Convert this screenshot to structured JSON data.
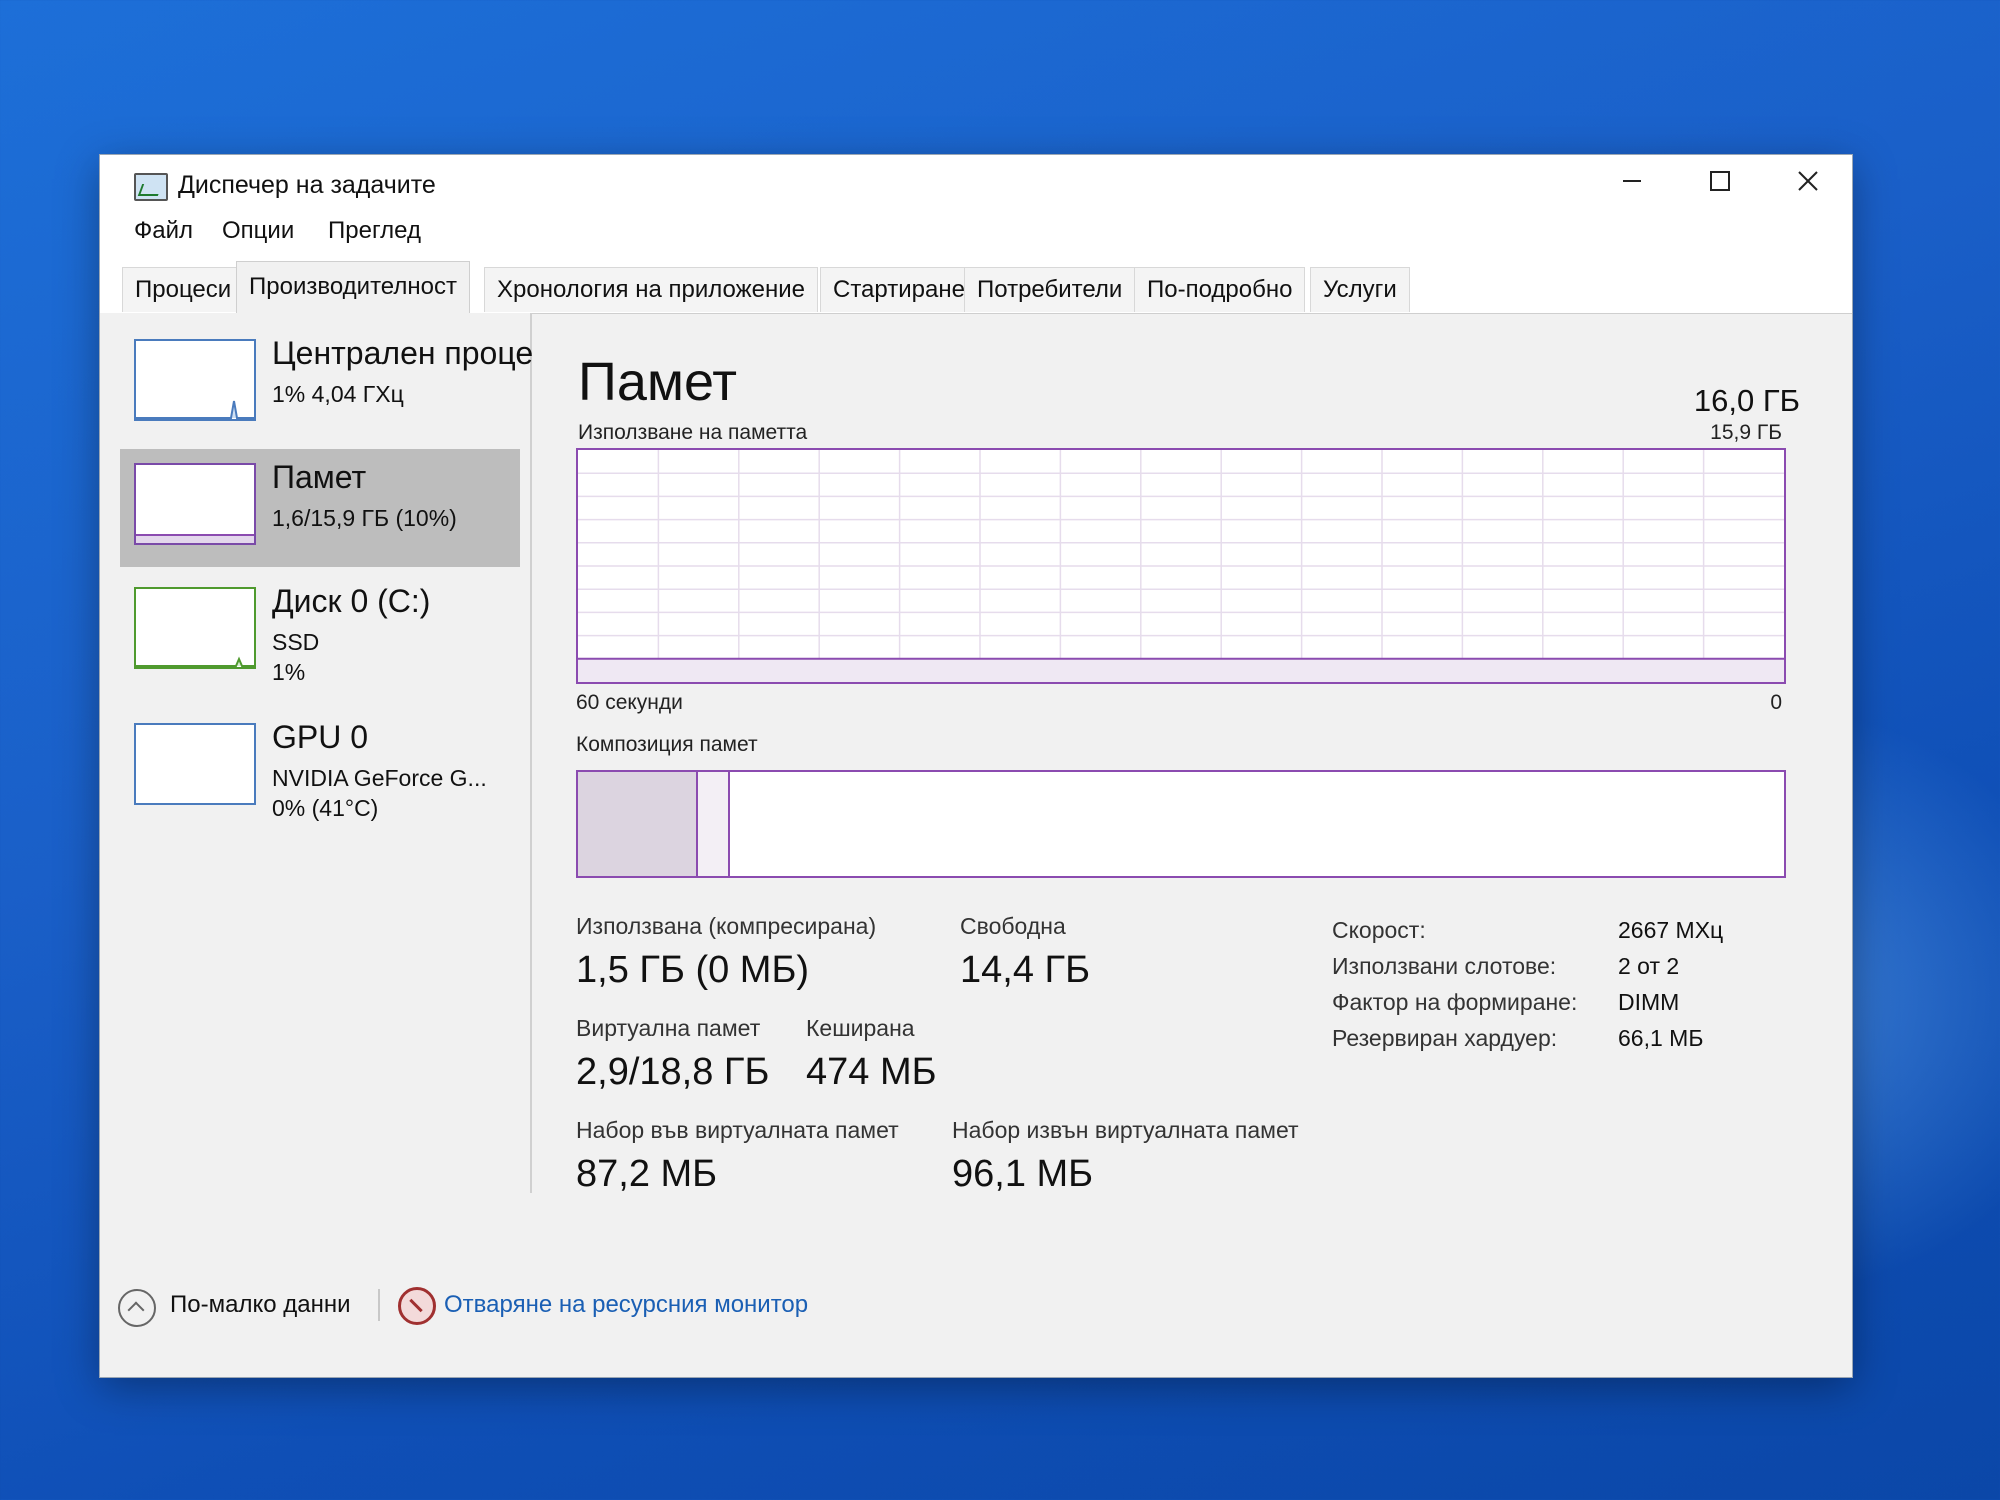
{
  "window": {
    "title": "Диспечер на задачите"
  },
  "menu": [
    "Файл",
    "Опции",
    "Преглед"
  ],
  "tabs": [
    {
      "label": "Процеси",
      "active": false
    },
    {
      "label": "Производителност",
      "active": true
    },
    {
      "label": "Хронология на приложение",
      "active": false
    },
    {
      "label": "Стартиране",
      "active": false
    },
    {
      "label": "Потребители",
      "active": false
    },
    {
      "label": "По-подробно",
      "active": false
    },
    {
      "label": "Услуги",
      "active": false
    }
  ],
  "sidebar": {
    "cpu": {
      "name": "Централен проце",
      "line1": "1% 4,04 ГХц"
    },
    "memory": {
      "name": "Памет",
      "line1": "1,6/15,9 ГБ (10%)"
    },
    "disk": {
      "name": "Диск 0 (C:)",
      "line1": "SSD",
      "line2": "1%"
    },
    "gpu": {
      "name": "GPU 0",
      "line1": "NVIDIA GeForce G...",
      "line2": "0% (41°C)"
    }
  },
  "memory_panel": {
    "title": "Памет",
    "total": "16,0 ГБ",
    "usage_label": "Използване на паметта",
    "usage_max": "15,9 ГБ",
    "time_label": "60 секунди",
    "zero_label": "0",
    "usage_fraction": 0.1,
    "composition_label": "Композиция памет"
  },
  "stats": {
    "used_label": "Използвана (компресирана)",
    "used_value": "1,5 ГБ (0 МБ)",
    "free_label": "Свободна",
    "free_value": "14,4 ГБ",
    "virtual_label": "Виртуална памет",
    "virtual_value": "2,9/18,8 ГБ",
    "cached_label": "Кеширана",
    "cached_value": "474 МБ",
    "paged_label": "Набор във виртуалната памет",
    "paged_value": "87,2 МБ",
    "nonpaged_label": "Набор извън виртуалната памет",
    "nonpaged_value": "96,1 МБ"
  },
  "specs": {
    "speed_label": "Скорост:",
    "speed_value": "2667 МХц",
    "slots_label": "Използвани слотове:",
    "slots_value": "2 от 2",
    "form_label": "Фактор на формиране:",
    "form_value": "DIMM",
    "reserved_label": "Резервиран хардуер:",
    "reserved_value": "66,1 МБ"
  },
  "footer": {
    "fewer_details": "По-малко данни",
    "resource_monitor": "Отваряне на ресурсния монитор"
  },
  "colors": {
    "memory_accent": "#8b4bb0",
    "cpu_accent": "#4a7bbd",
    "disk_accent": "#4f9a2e",
    "link": "#1a5fb4"
  }
}
